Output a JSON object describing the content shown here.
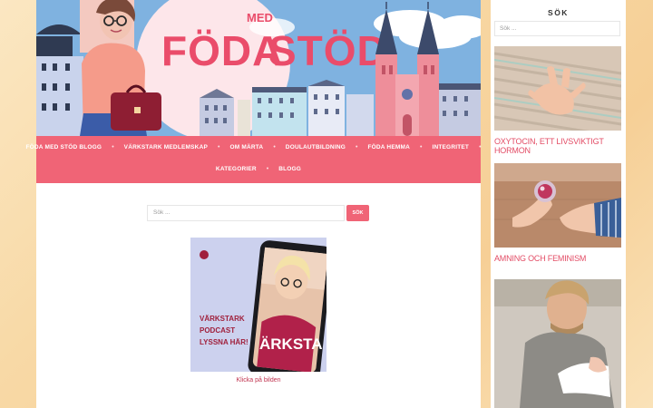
{
  "banner": {
    "logo_top": "MED",
    "logo_left": "FÖDA",
    "logo_right": "STÖD"
  },
  "nav": {
    "row1": [
      "FÖDA MED STÖD BLOGG",
      "VÄRKSTARK MEDLEMSKAP",
      "OM MÄRTA",
      "DOULAUTBILDNING",
      "FÖDA HEMMA",
      "INTEGRITET"
    ],
    "row2": [
      "KATEGORIER",
      "BLOGG"
    ],
    "separator": "•"
  },
  "main_search": {
    "placeholder": "Sök ...",
    "button": "SÖK"
  },
  "podcast": {
    "text_line1": "VÄRKSTARK",
    "text_line2": "PODCAST",
    "text_line3": "LYSSNA HÄR!",
    "phone_text": "ÄRKSTA",
    "caption": "Klicka på bilden"
  },
  "sidebar": {
    "title": "SÖK",
    "search_placeholder": "Sök ...",
    "posts": [
      {
        "title": "OXYTOCIN, ETT LIVSVIKTIGT HORMON"
      },
      {
        "title": "AMNING OCH FEMINISM"
      }
    ]
  },
  "colors": {
    "accent": "#f06476",
    "link": "#c0334f",
    "title": "#e34d66"
  }
}
